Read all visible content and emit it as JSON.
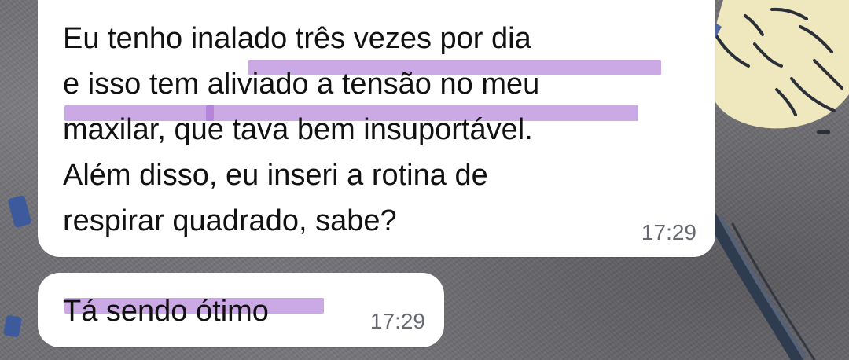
{
  "messages": [
    {
      "text": "Eu tenho inalado três vezes por dia\ne isso tem aliviado a tensão no meu\nmaxilar, que tava bem insuportável.\nAlém disso, eu inseri a rotina de\nrespirar quadrado, sabe?",
      "time": "17:29"
    },
    {
      "text": "Tá sendo ótimo",
      "time": "17:29"
    }
  ],
  "colors": {
    "highlight": "#a56bd2",
    "bubble": "#ffffff",
    "timestamp": "#666a70"
  }
}
